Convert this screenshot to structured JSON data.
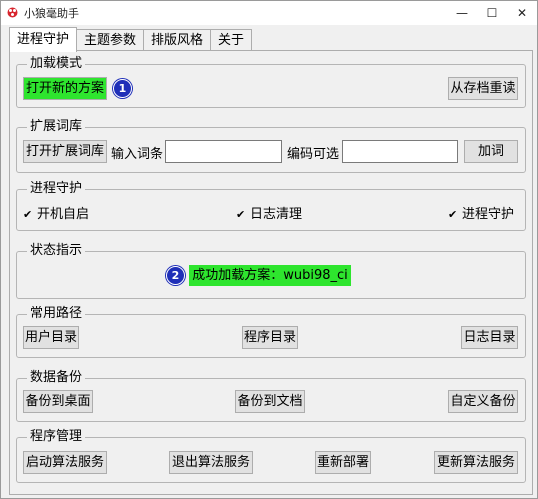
{
  "window": {
    "title": "小狼毫助手",
    "minimize_glyph": "—",
    "maximize_glyph": "☐",
    "close_glyph": "✕"
  },
  "tabs": [
    {
      "label": "进程守护",
      "active": true
    },
    {
      "label": "主题参数",
      "active": false
    },
    {
      "label": "排版风格",
      "active": false
    },
    {
      "label": "关于",
      "active": false
    }
  ],
  "load_mode": {
    "legend": "加载模式",
    "open_new_label": "打开新的方案",
    "reload_label": "从存档重读",
    "marker": "1"
  },
  "dict": {
    "legend": "扩展词库",
    "open_label": "打开扩展词库",
    "entry_label": "输入词条",
    "entry_value": "",
    "code_label": "编码可选",
    "code_value": "",
    "add_label": "加词"
  },
  "guard": {
    "legend": "进程守护",
    "items": [
      {
        "label": "开机自启",
        "checked": true
      },
      {
        "label": "日志清理",
        "checked": true
      },
      {
        "label": "进程守护",
        "checked": true
      }
    ]
  },
  "status": {
    "legend": "状态指示",
    "text": "成功加载方案：wubi98_ci",
    "marker": "2"
  },
  "paths": {
    "legend": "常用路径",
    "user_dir": "用户目录",
    "program_dir": "程序目录",
    "log_dir": "日志目录"
  },
  "backup": {
    "legend": "数据备份",
    "to_desktop": "备份到桌面",
    "to_docs": "备份到文档",
    "custom": "自定义备份"
  },
  "manage": {
    "legend": "程序管理",
    "start": "启动算法服务",
    "quit": "退出算法服务",
    "redeploy": "重新部署",
    "update": "更新算法服务"
  },
  "colors": {
    "highlight_green": "#2ee52e",
    "marker_blue": "#1f2fb8",
    "app_icon_red": "#d8262e"
  },
  "icons": [
    "app-logo-icon",
    "minimize-icon",
    "maximize-icon",
    "close-icon",
    "checkbox-checked-icon"
  ]
}
